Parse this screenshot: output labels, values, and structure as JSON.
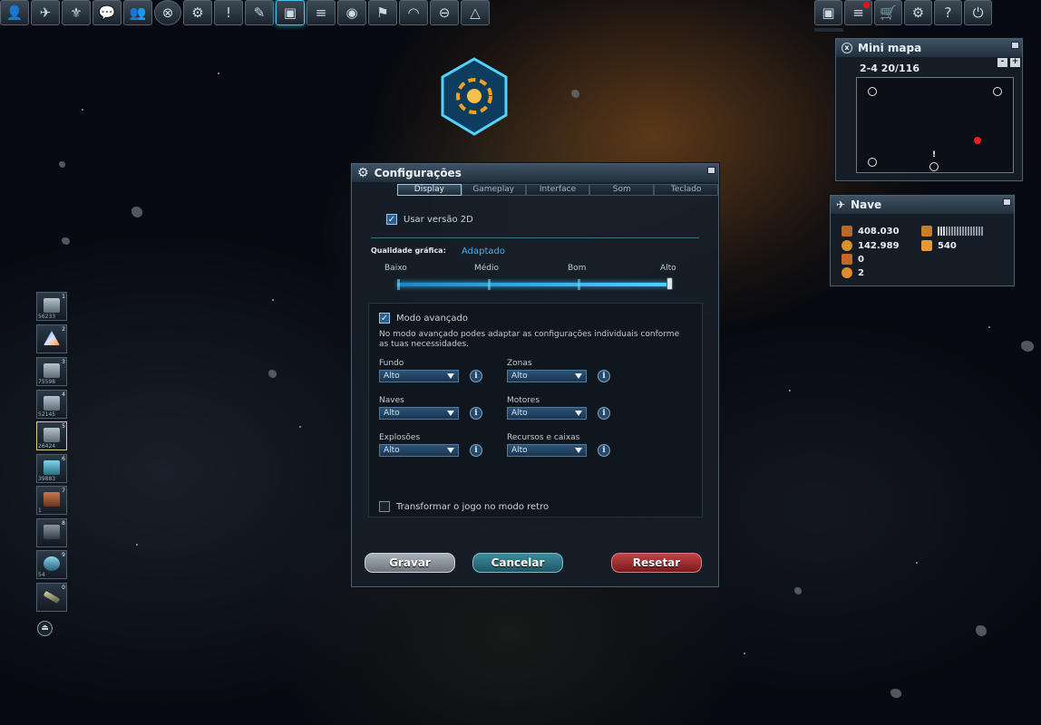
{
  "toolbar": {
    "left_icons": [
      "user-icon",
      "ship-icon",
      "clan-icon",
      "chat-icon",
      "group-icon",
      "logo-icon",
      "skilltree-icon",
      "alert-icon",
      "galaxy-gate-icon",
      "display-settings-icon",
      "log-icon",
      "pet-icon",
      "profile-icon",
      "speed-icon",
      "rocket-icon",
      "triangle-icon"
    ],
    "right_icons": [
      "premium-icon",
      "quest-icon",
      "shop-icon",
      "settings-icon",
      "help-icon",
      "logout-icon"
    ]
  },
  "minimap": {
    "title": "Mini mapa",
    "coords": "2-4 20/116",
    "plus": "+",
    "minus": "-"
  },
  "ship": {
    "title": "Nave",
    "hp": "408.030",
    "shield": "142.989",
    "cargo": "540",
    "speed": "0",
    "config": "2"
  },
  "hotbar": [
    {
      "num": "56233",
      "key": "1"
    },
    {
      "num": "",
      "key": "2"
    },
    {
      "num": "75598",
      "key": "3"
    },
    {
      "num": "52145",
      "key": "4"
    },
    {
      "num": "26424",
      "key": "5"
    },
    {
      "num": "39883",
      "key": "6"
    },
    {
      "num": "1",
      "key": "7"
    },
    {
      "num": "",
      "key": "8"
    },
    {
      "num": "54",
      "key": "9"
    },
    {
      "num": "",
      "key": "0"
    }
  ],
  "settings": {
    "title": "Configurações",
    "tabs": [
      "Display",
      "Gameplay",
      "Interface",
      "Som",
      "Teclado"
    ],
    "use_2d": "Usar versão 2D",
    "quality_label": "Qualidade gráfica:",
    "quality_value": "Adaptado",
    "levels": [
      "Baixo",
      "Médio",
      "Bom",
      "Alto"
    ],
    "advanced_label": "Modo avançado",
    "advanced_desc": "No modo avançado podes adaptar as configurações individuais conforme as tuas necessidades.",
    "options": [
      {
        "label": "Fundo",
        "value": "Alto"
      },
      {
        "label": "Zonas",
        "value": "Alto"
      },
      {
        "label": "Naves",
        "value": "Alto"
      },
      {
        "label": "Motores",
        "value": "Alto"
      },
      {
        "label": "Explosões",
        "value": "Alto"
      },
      {
        "label": "Recursos e caixas",
        "value": "Alto"
      }
    ],
    "retro": "Transformar o jogo no modo retro",
    "save": "Gravar",
    "cancel": "Cancelar",
    "reset": "Resetar"
  },
  "colors": {
    "accent": "#4fc0ef",
    "reset": "#c24346",
    "cancel": "#3e8b9c"
  }
}
